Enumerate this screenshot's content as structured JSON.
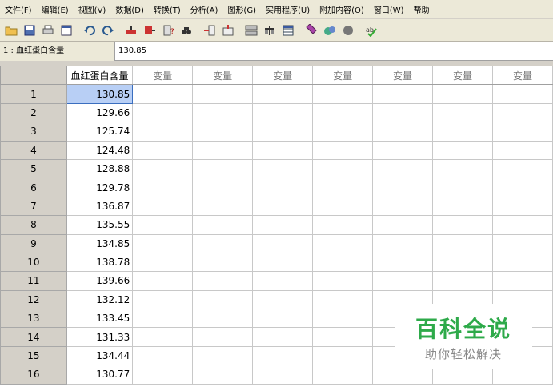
{
  "menu": [
    {
      "label": "文件(F)"
    },
    {
      "label": "编辑(E)"
    },
    {
      "label": "视图(V)"
    },
    {
      "label": "数据(D)"
    },
    {
      "label": "转换(T)"
    },
    {
      "label": "分析(A)"
    },
    {
      "label": "图形(G)"
    },
    {
      "label": "实用程序(U)"
    },
    {
      "label": "附加内容(O)"
    },
    {
      "label": "窗口(W)"
    },
    {
      "label": "帮助"
    }
  ],
  "toolbar": {
    "icons": [
      "open-icon",
      "save-icon",
      "print-icon",
      "dialog-recall-icon",
      "undo-icon",
      "redo-icon",
      "goto-case-icon",
      "goto-variable-icon",
      "variables-icon",
      "find-icon",
      "insert-cases-icon",
      "insert-variable-icon",
      "split-file-icon",
      "weight-cases-icon",
      "select-cases-icon",
      "value-labels-icon",
      "use-sets-icon",
      "show-all-variables-icon",
      "spelling-icon"
    ]
  },
  "editor": {
    "cell_ref": "1 : 血红蛋白含量",
    "cell_value": "130.85"
  },
  "grid": {
    "columns": [
      "血红蛋白含量",
      "变量",
      "变量",
      "变量",
      "变量",
      "变量",
      "变量",
      "变量"
    ],
    "rows": [
      {
        "num": "1",
        "value": "130.85"
      },
      {
        "num": "2",
        "value": "129.66"
      },
      {
        "num": "3",
        "value": "125.74"
      },
      {
        "num": "4",
        "value": "124.48"
      },
      {
        "num": "5",
        "value": "128.88"
      },
      {
        "num": "6",
        "value": "129.78"
      },
      {
        "num": "7",
        "value": "136.87"
      },
      {
        "num": "8",
        "value": "135.55"
      },
      {
        "num": "9",
        "value": "134.85"
      },
      {
        "num": "10",
        "value": "138.78"
      },
      {
        "num": "11",
        "value": "139.66"
      },
      {
        "num": "12",
        "value": "132.12"
      },
      {
        "num": "13",
        "value": "133.45"
      },
      {
        "num": "14",
        "value": "131.33"
      },
      {
        "num": "15",
        "value": "134.44"
      },
      {
        "num": "16",
        "value": "130.77"
      }
    ]
  },
  "watermark": {
    "title": "百科全说",
    "subtitle": "助你轻松解决"
  },
  "colors": {
    "selected_cell": "#b8cff5",
    "watermark_green": "#2eaa4a",
    "chrome": "#ece9d8"
  }
}
